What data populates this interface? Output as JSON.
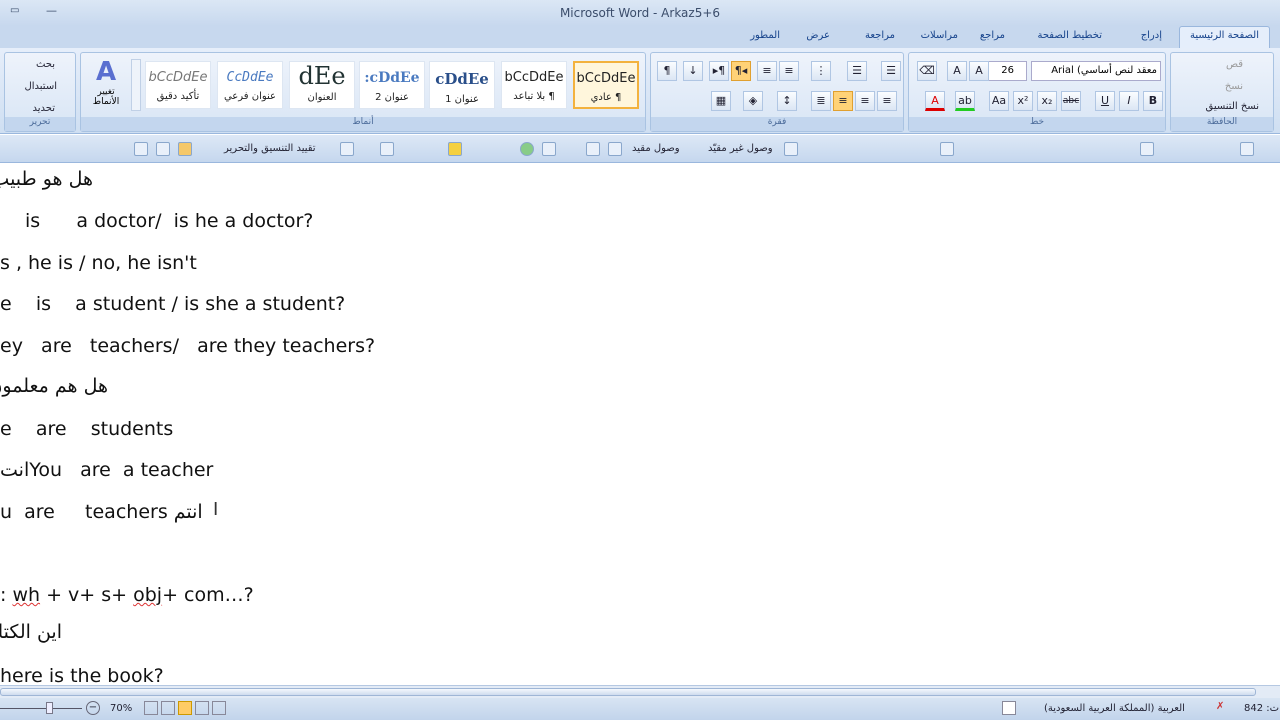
{
  "window": {
    "title": "Microsoft Word - Arkaz5+6"
  },
  "tabs": [
    "الصفحة الرئيسية",
    "إدراج",
    "تخطيط الصفحة",
    "مراجع",
    "مراسلات",
    "مراجعة",
    "عرض",
    "المطور"
  ],
  "clipboard": {
    "cut": "قص",
    "copy": "نسخ",
    "format_painter": "نسخ التنسيق",
    "label": "الحافظة"
  },
  "font": {
    "name": "معقد لنص أساسي) Arial",
    "size": "26",
    "label": "خط"
  },
  "paragraph": {
    "label": "فقرة"
  },
  "styles": {
    "label": "أنماط",
    "change": "تغيير الأنماط",
    "items": [
      {
        "preview": "bCcDdEe",
        "name": "¶ عادي"
      },
      {
        "preview": "bCcDdEe",
        "name": "¶ بلا تباعد"
      },
      {
        "preview": "cDdEe",
        "name": "عنوان 1"
      },
      {
        "preview": ":cDdEe",
        "name": "عنوان 2"
      },
      {
        "preview": "dEe",
        "name": "العنوان"
      },
      {
        "preview": "CcDdEe",
        "name": "عنوان فرعي"
      },
      {
        "preview": "bCcDdEe",
        "name": "تأكيد دقيق"
      }
    ]
  },
  "editing": {
    "find": "بحث",
    "replace": "استبدال",
    "select": "تحديد",
    "label": "تحرير"
  },
  "qat": {
    "restrict": "تقييد التنسيق والتحرير",
    "linked": "وصول مقيد",
    "unlinked": "وصول غير مقيّد"
  },
  "document": {
    "lines": [
      "هل هو طبيب",
      "is      a doctor/  is he a doctor?",
      "s , he is / no, he isn't",
      "e    is    a student / is she a student?",
      "ey   are   teachers/   are they teachers?",
      "هل هم معلمون",
      "e    are    students",
      "You   are  a teacher",
      "u  are     teachers انتم",
      "اين الكتا",
      "here is the book?"
    ],
    "line8_prefix": "انت",
    "formula": {
      "a": ": ",
      "wh": "wh",
      " b": " + v+ s+ ",
      "obj": "obj",
      "c": "+ com…?"
    }
  },
  "status": {
    "zoom": "70%",
    "language": "العربية (المملكة العربية السعودية)",
    "words": "842 :ت"
  }
}
